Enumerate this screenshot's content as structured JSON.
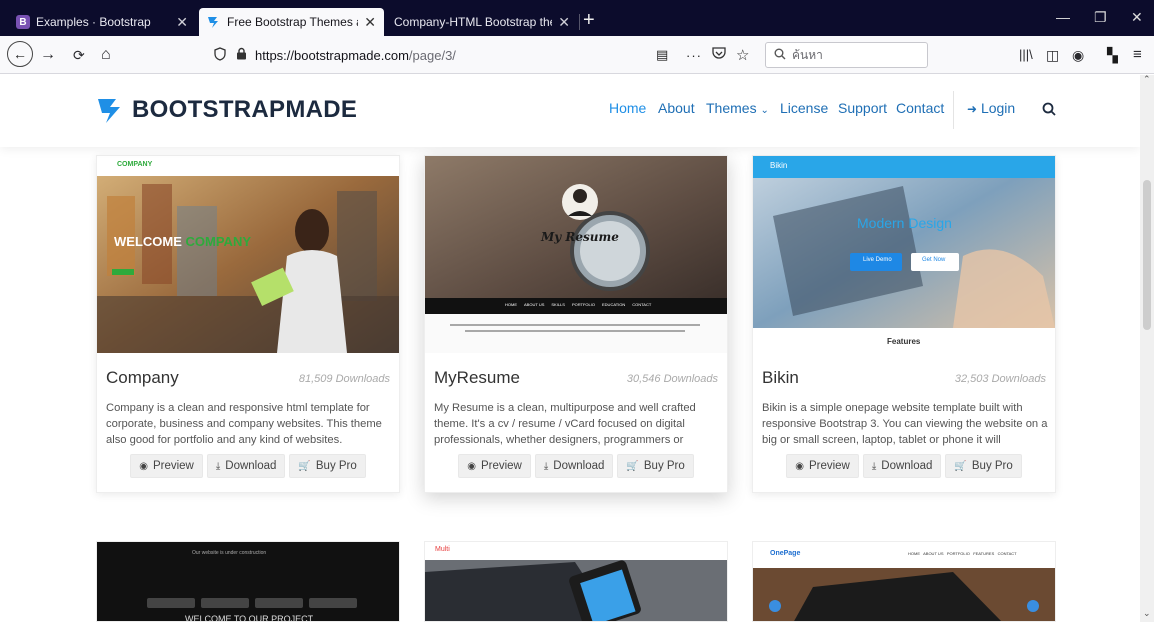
{
  "tabs": [
    {
      "favicon": "B",
      "title": "Examples · Bootstrap",
      "favicon_color": "#7952b3"
    },
    {
      "favicon": "bootstrapmade",
      "title": "Free Bootstrap Themes and We",
      "active": true
    },
    {
      "favicon": "",
      "title": "Company-HTML Bootstrap theme"
    }
  ],
  "url": {
    "host": "https://bootstrapmade.com",
    "path": "/page/3/"
  },
  "search_placeholder": "ค้นหา",
  "site": {
    "logo": "BOOTSTRAPMADE",
    "nav": {
      "home": "Home",
      "about": "About",
      "themes": "Themes",
      "license": "License",
      "support": "Support",
      "contact": "Contact",
      "login": "Login"
    }
  },
  "cards": [
    {
      "title": "Company",
      "downloads": "81,509 Downloads",
      "desc": "Company is a clean and responsive html template for corporate, business and company websites. This theme also good for portfolio and any kind of websites.",
      "thumb": {
        "brand": "COMPANY",
        "headline_a": "WELCOME",
        "headline_b": "COMPANY"
      }
    },
    {
      "title": "MyResume",
      "downloads": "30,546 Downloads",
      "desc": "My Resume is a clean, multipurpose and well crafted theme. It's a cv / resume / vCard focused on digital professionals, whether designers, programmers or",
      "thumb": {
        "headline": "My Resume",
        "menu": [
          "HOME",
          "ABOUT US",
          "SKILLS",
          "PORTFOLIO",
          "EDUCATION",
          "CONTACT"
        ]
      }
    },
    {
      "title": "Bikin",
      "downloads": "32,503 Downloads",
      "desc": "Bikin is a simple onepage website template built with responsive Bootstrap 3. You can viewing the website on a big or small screen, laptop, tablet or phone it will",
      "thumb": {
        "brand": "Bikin",
        "headline": "Modern Design",
        "btn1": "Live Demo",
        "btn2": "Get Now",
        "features": "Features"
      }
    }
  ],
  "buttons": {
    "preview": "Preview",
    "download": "Download",
    "buy": "Buy Pro"
  },
  "row2": [
    {
      "headline": "WELCOME TO OUR PROJECT",
      "sub": "Our website is under construction"
    },
    {
      "brand": "Multi"
    },
    {
      "brand": "OnePage",
      "menu": "HOME   ABOUT US   PORTFOLIO   FEATURES   CONTACT"
    }
  ],
  "colors": {
    "brand_blue": "#1f8fe6",
    "nav_text": "#1f6fb5",
    "tabbar": "#0c0c2c"
  }
}
